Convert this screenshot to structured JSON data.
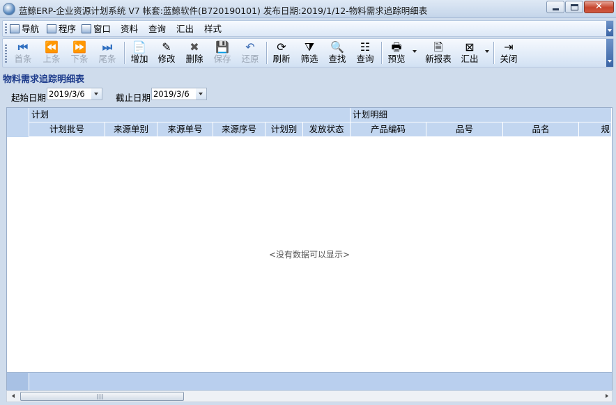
{
  "window": {
    "title": "蓝鲸ERP-企业资源计划系统 V7 帐套:蓝鲸软件(B720190101) 发布日期:2019/1/12-物料需求追踪明细表",
    "close_glyph": "✕"
  },
  "menu": {
    "items": [
      {
        "label": "导航",
        "icon": "navigation-icon"
      },
      {
        "label": "程序",
        "icon": "program-icon"
      },
      {
        "label": "窗口",
        "icon": "window-icon"
      },
      {
        "label": "资料"
      },
      {
        "label": "查询"
      },
      {
        "label": "汇出"
      },
      {
        "label": "样式"
      }
    ]
  },
  "toolbar": {
    "buttons": [
      {
        "label": "首条",
        "icon": "first-record-icon",
        "glyph": "⏮",
        "enabled": false
      },
      {
        "label": "上条",
        "icon": "previous-record-icon",
        "glyph": "⏪",
        "enabled": false
      },
      {
        "label": "下条",
        "icon": "next-record-icon",
        "glyph": "⏩",
        "enabled": false
      },
      {
        "label": "尾条",
        "icon": "last-record-icon",
        "glyph": "⏭",
        "enabled": false
      },
      {
        "label": "增加",
        "icon": "add-icon",
        "glyph": "📄",
        "enabled": true
      },
      {
        "label": "修改",
        "icon": "edit-icon",
        "glyph": "✎",
        "enabled": true
      },
      {
        "label": "删除",
        "icon": "delete-icon",
        "glyph": "✖",
        "enabled": true
      },
      {
        "label": "保存",
        "icon": "save-icon",
        "glyph": "💾",
        "enabled": false
      },
      {
        "label": "还原",
        "icon": "undo-icon",
        "glyph": "↶",
        "enabled": false
      },
      {
        "label": "刷新",
        "icon": "refresh-icon",
        "glyph": "⟳",
        "enabled": true
      },
      {
        "label": "筛选",
        "icon": "filter-icon",
        "glyph": "⧩",
        "enabled": true
      },
      {
        "label": "查找",
        "icon": "find-binoculars-icon",
        "glyph": "🔍",
        "enabled": true
      },
      {
        "label": "查询",
        "icon": "query-icon",
        "glyph": "☷",
        "enabled": true
      },
      {
        "label": "预览",
        "icon": "print-preview-icon",
        "glyph": "🖶",
        "enabled": true
      },
      {
        "label": "新报表",
        "icon": "new-report-icon",
        "glyph": "🗎",
        "enabled": true
      },
      {
        "label": "汇出",
        "icon": "export-icon",
        "glyph": "⊠",
        "enabled": true
      },
      {
        "label": "关闭",
        "icon": "close-door-icon",
        "glyph": "⇥",
        "enabled": true
      }
    ]
  },
  "form": {
    "title": "物料需求追踪明细表",
    "start_date_label": "起始日期",
    "start_date_value": "2019/3/6",
    "end_date_label": "截止日期",
    "end_date_value": "2019/3/6"
  },
  "grid": {
    "groups": [
      "计划",
      "计划明细"
    ],
    "columns": [
      "计划批号",
      "来源单别",
      "来源单号",
      "来源序号",
      "计划别",
      "发放状态",
      "产品编码",
      "品号",
      "品名",
      "规"
    ],
    "empty_message": "<没有数据可以显示>"
  },
  "scrollbar": {
    "grip_glyph": "III"
  }
}
